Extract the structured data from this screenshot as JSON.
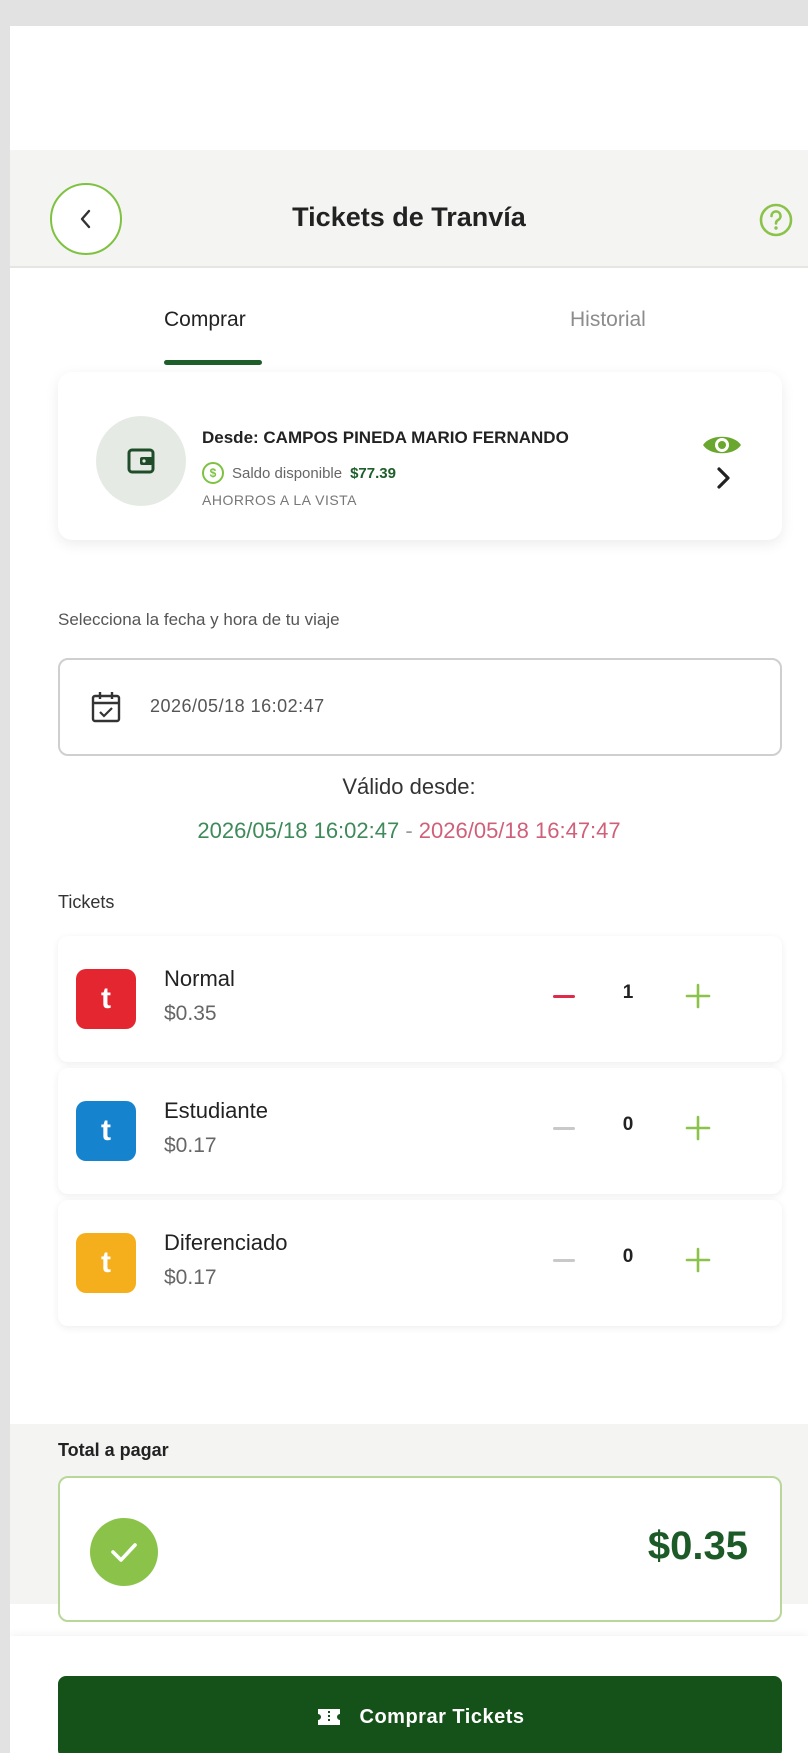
{
  "header": {
    "title": "Tickets de Tranvía",
    "back_icon": "chevron-left-icon",
    "help_icon": "question-circle-icon"
  },
  "tabs": [
    {
      "label": "Comprar",
      "active": true
    },
    {
      "label": "Historial",
      "active": false
    }
  ],
  "account": {
    "from_label": "Desde: CAMPOS PINEDA MARIO FERNANDO",
    "balance_label": "Saldo disponible",
    "balance_amount": "$77.39",
    "account_type": "AHORROS A LA VISTA"
  },
  "date_section": {
    "label": "Selecciona la fecha y hora de tu viaje",
    "value": "2026/05/18 16:02:47",
    "valid_label": "Válido desde:",
    "valid_from": "2026/05/18 16:02:47",
    "valid_separator": " - ",
    "valid_to": "2026/05/18 16:47:47"
  },
  "tickets_label": "Tickets",
  "tickets": [
    {
      "name": "Normal",
      "price": "$0.35",
      "qty": "1",
      "badge_letter": "t",
      "color": "#e3262f",
      "minus_color": "#e02a4a"
    },
    {
      "name": "Estudiante",
      "price": "$0.17",
      "qty": "0",
      "badge_letter": "t",
      "color": "#1683cf",
      "minus_color": "#c9c9c9"
    },
    {
      "name": "Diferenciado",
      "price": "$0.17",
      "qty": "0",
      "badge_letter": "t",
      "color": "#f5ae1c",
      "minus_color": "#c9c9c9"
    }
  ],
  "total": {
    "label": "Total a pagar",
    "amount": "$0.35"
  },
  "buy_button": {
    "label": "Comprar Tickets",
    "icon": "ticket-icon"
  },
  "colors": {
    "brand_dark_green": "#155219",
    "accent_green": "#7fc241",
    "valid_from": "#3e8a5a",
    "valid_to": "#d0607a"
  }
}
